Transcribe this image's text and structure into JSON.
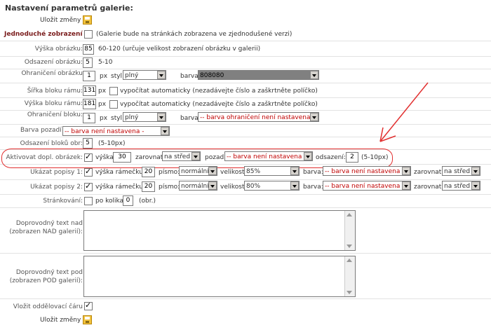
{
  "heading": "Nastavení parametrů galerie:",
  "save_label": "Uložit změny",
  "simple": {
    "label": "Jednoduché zobrazení",
    "note": "(Galerie bude na stránkách zobrazena ve zjednodušené verzi)"
  },
  "image_height": {
    "label": "Výška obrázku:",
    "value": "85",
    "note": "60-120 (určuje velikost zobrazení obrázku v galerii)"
  },
  "image_spacing": {
    "label": "Odsazení obrázku:",
    "value": "5",
    "note": "5-10"
  },
  "image_border": {
    "label": "Ohraničení obrázku",
    "value": "1",
    "px": "px",
    "style_label": "styl:",
    "style_value": "plný",
    "color_label": "barva:",
    "color_value": "808080"
  },
  "frame_width": {
    "label": "Šířka bloku rámu:",
    "value": "131",
    "px": "px",
    "note": "vypočítat automaticky (nezadávejte číslo a zaškrtněte políčko)"
  },
  "frame_height": {
    "label": "Výška bloku rámu:",
    "value": "181",
    "px": "px",
    "note": "vypočítat automaticky (nezadávejte číslo a zaškrtněte políčko)"
  },
  "block_border": {
    "label": "Ohraničení bloku:",
    "value": "1",
    "px": "px",
    "style_label": "styl:",
    "style_value": "plný",
    "color_label": "barva:",
    "color_value": "-- barva ohraničení není nastavena --"
  },
  "block_bg": {
    "label": "Barva pozadí bloku:",
    "value": "-- barva není nastavena -"
  },
  "block_spacing": {
    "label": "Odsazení bloků obr:",
    "value": "5",
    "note": "(5-10px)"
  },
  "extra_image": {
    "label": "Aktivovat dopl. obrázek:",
    "height_label": "výška:",
    "height_value": "30",
    "align_label": "zarovnat:",
    "align_value": "na střed",
    "bg_label": "pozadí:",
    "bg_value": "-- barva není nastavena -",
    "spacing_label": "odsazení:",
    "spacing_value": "2",
    "spacing_note": "(5-10px)"
  },
  "caption1": {
    "label": "Ukázat popisy 1:",
    "height_label": "výška rámečku:",
    "height_value": "20",
    "font_label": "písmo:",
    "font_value": "normální",
    "size_label": "velikost:",
    "size_value": "85%",
    "color_label": "barva:",
    "color_value": "-- barva není nastavena -",
    "align_label": "zarovnat:",
    "align_value": "na střed"
  },
  "caption2": {
    "label": "Ukázat popisy 2:",
    "height_label": "výška rámečku:",
    "height_value": "20",
    "font_label": "písmo:",
    "font_value": "normální",
    "size_label": "velikost:",
    "size_value": "80%",
    "color_label": "barva:",
    "color_value": "-- barva není nastavena -",
    "align_label": "zarovnat:",
    "align_value": "na střed"
  },
  "paging": {
    "label": "Stránkování:",
    "after_label": "po kolika:",
    "value": "0",
    "note": "(obr.)"
  },
  "text_above": {
    "label1": "Doprovodný text nad",
    "label2": "(zobrazen NAD galerií):"
  },
  "text_below": {
    "label1": "Doprovodný text pod",
    "label2": "(zobrazen POD galerií):"
  },
  "divider": {
    "label": "Vložit oddělovací čáru"
  }
}
